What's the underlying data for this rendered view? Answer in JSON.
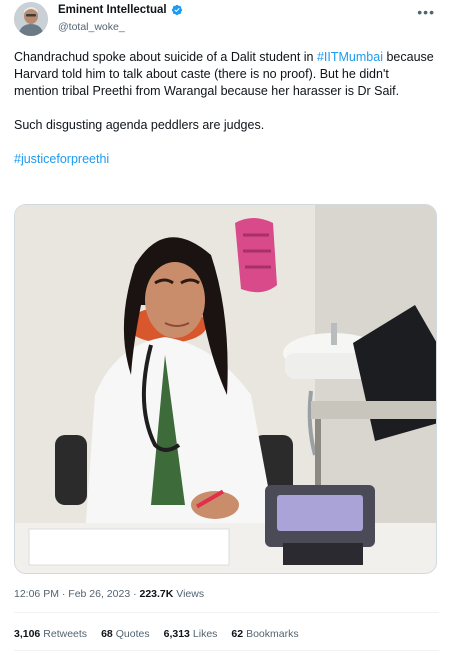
{
  "tweet": {
    "author_name": "Eminent Intellectual",
    "author_handle": "@total_woke_",
    "text_p1_a": "Chandrachud spoke about suicide of a Dalit student in ",
    "hashtag1": "#IITMumbai",
    "text_p1_b": " because Harvard told him to talk about caste (there is no proof). But he didn't mention tribal Preethi from Warangal because her harasser is Dr Saif.",
    "text_p2": "Such disgusting agenda peddlers are judges.",
    "hashtag2": "#justiceforpreethi",
    "time": "12:06 PM · Feb 26, 2023 · ",
    "views_count": "223.7K",
    "views_label": " Views"
  },
  "stats": [
    {
      "count": "3,106",
      "label": "Retweets"
    },
    {
      "count": "68",
      "label": "Quotes"
    },
    {
      "count": "6,313",
      "label": "Likes"
    },
    {
      "count": "62",
      "label": "Bookmarks"
    }
  ],
  "icons": {
    "verified": "verified-badge-icon",
    "more": "more-options-icon"
  },
  "colors": {
    "link": "#1d9bf0",
    "text": "#0f1419",
    "muted": "#536471",
    "border": "#cfd9de"
  }
}
